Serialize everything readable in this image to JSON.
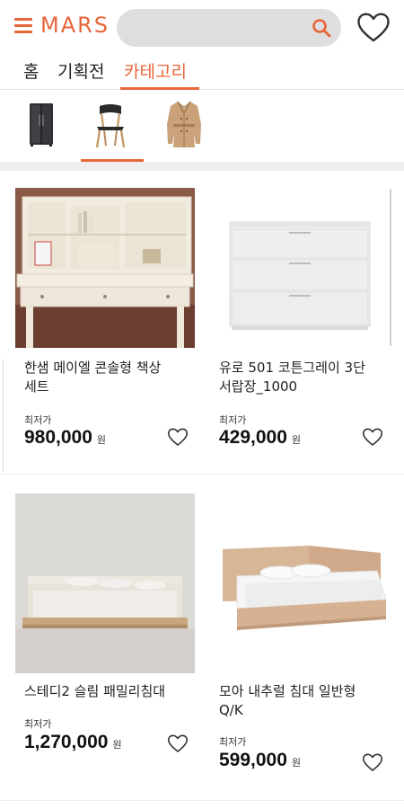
{
  "header": {
    "logo": "MARS",
    "search_value": "",
    "accent_color": "#e8663a",
    "menu_icon": "hamburger-menu-icon",
    "search_icon": "search-icon",
    "wishlist_icon": "heart-outline-icon"
  },
  "tabs": [
    {
      "label": "홈",
      "active": false
    },
    {
      "label": "기획전",
      "active": false
    },
    {
      "label": "카테고리",
      "active": true
    }
  ],
  "categories": [
    {
      "icon": "refrigerator-icon",
      "active": false
    },
    {
      "icon": "chair-icon",
      "active": true
    },
    {
      "icon": "trench-coat-icon",
      "active": false
    }
  ],
  "products": [
    {
      "name_line1": "한샘 메이엘 콘솔형 책상",
      "name_line2": "세트",
      "price_label": "최저가",
      "price": "980,000",
      "unit": "원",
      "image": "desk-with-hutch-image"
    },
    {
      "name_line1": "유로 501 코튼그레이 3단",
      "name_line2": "서랍장_1000",
      "price_label": "최저가",
      "price": "429,000",
      "unit": "원",
      "image": "three-drawer-chest-image"
    },
    {
      "name_line1": "스테디2 슬림 패밀리침대",
      "name_line2": "",
      "price_label": "최저가",
      "price": "1,270,000",
      "unit": "원",
      "image": "family-bed-image"
    },
    {
      "name_line1": "모아 내추럴 침대 일반형",
      "name_line2": "Q/K",
      "price_label": "최저가",
      "price": "599,000",
      "unit": "원",
      "image": "natural-bed-image"
    }
  ]
}
